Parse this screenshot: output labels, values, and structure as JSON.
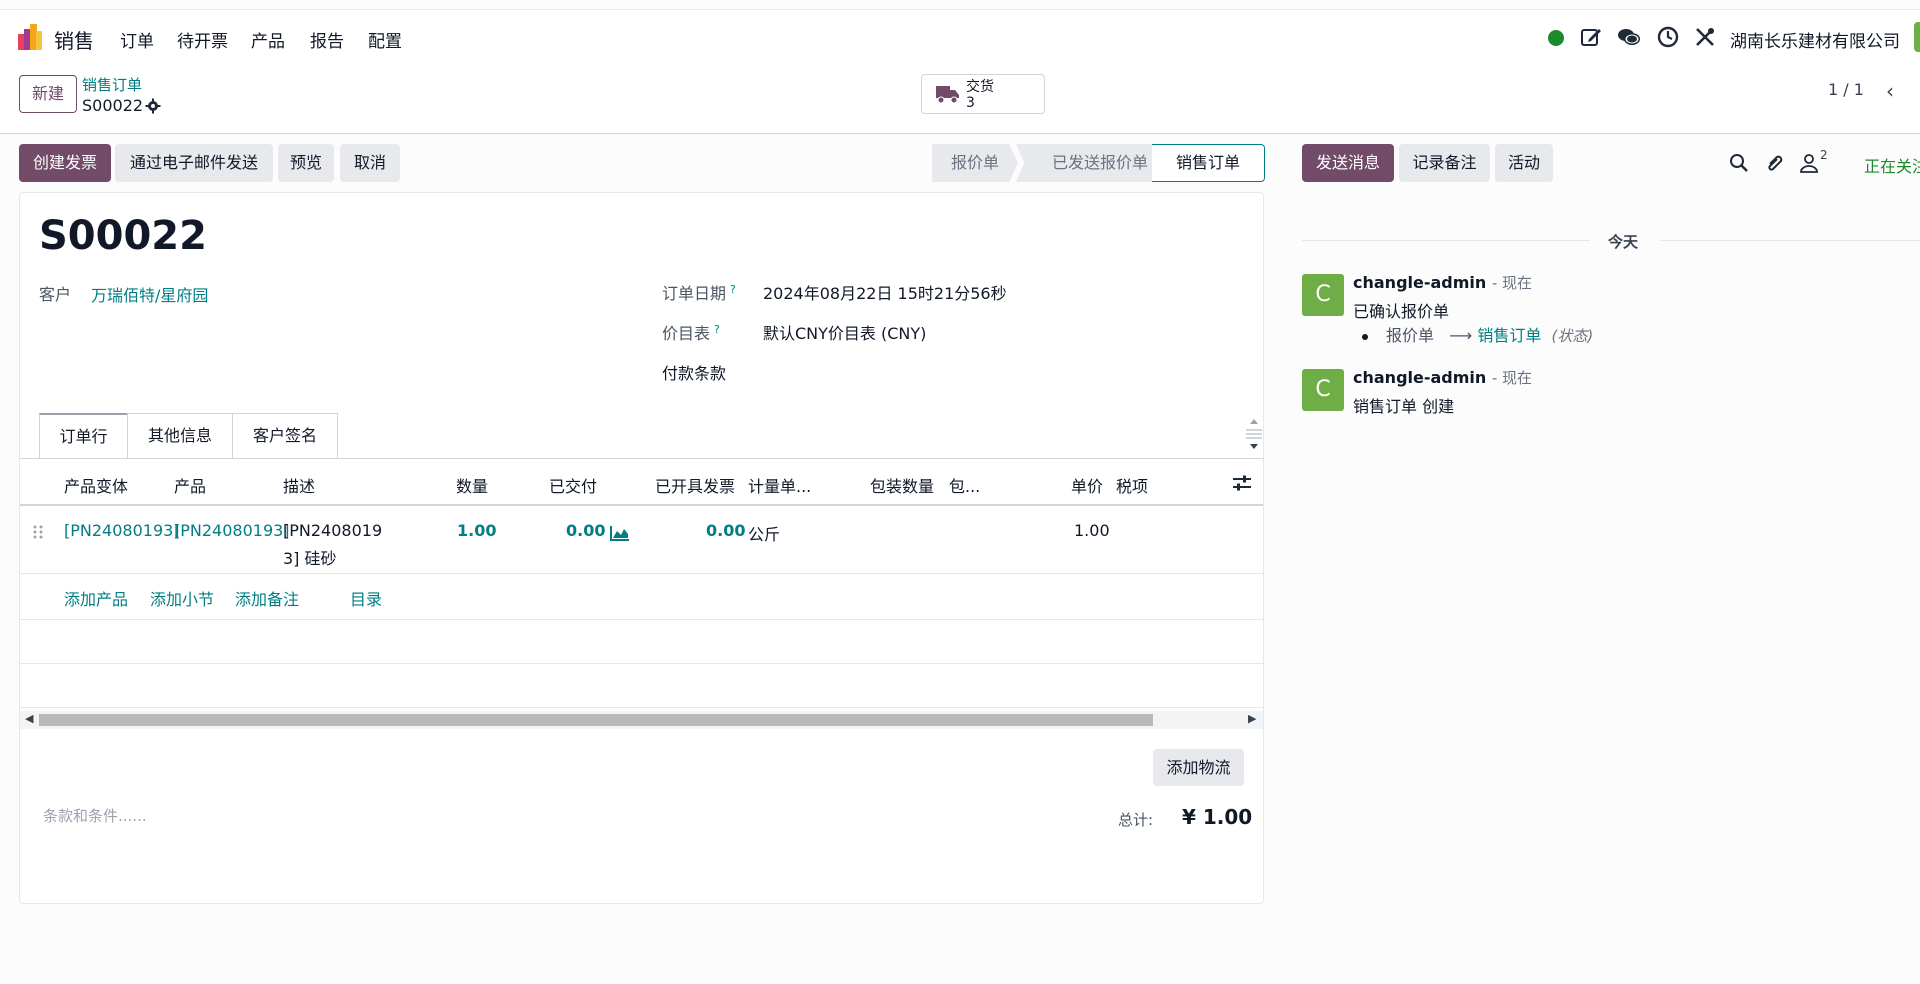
{
  "topnav": {
    "app_name": "销售",
    "menu": [
      "订单",
      "待开票",
      "产品",
      "报告",
      "配置"
    ],
    "company": "湖南长乐建材有限公司",
    "icons": [
      "online-status-icon",
      "edit-icon",
      "chat-icon",
      "clock-icon",
      "tools-icon"
    ],
    "status_color": "#1a8a2a"
  },
  "control": {
    "new_label": "新建",
    "breadcrumb_parent": "销售订单",
    "breadcrumb_current": "S00022",
    "smart_button": {
      "label": "交货",
      "count": "3"
    },
    "pager": "1 / 1"
  },
  "actions": {
    "create_invoice": "创建发票",
    "send_email": "通过电子邮件发送",
    "preview": "预览",
    "cancel": "取消"
  },
  "statusbar": {
    "stages": [
      "报价单",
      "已发送报价单",
      "销售订单"
    ],
    "active": "销售订单"
  },
  "form": {
    "title": "S00022",
    "customer_label": "客户",
    "customer_value": "万瑞佰特/星府园",
    "order_date_label": "订单日期",
    "order_date_value": "2024年08月22日 15时21分56秒",
    "pricelist_label": "价目表",
    "pricelist_value": "默认CNY价目表 (CNY)",
    "payment_terms_label": "付款条款",
    "help_mark": "?"
  },
  "tabs": [
    "订单行",
    "其他信息",
    "客户签名"
  ],
  "table": {
    "headers": [
      "产品变体",
      "产品",
      "描述",
      "数量",
      "已交付",
      "已开具发票",
      "计量单...",
      "包装数量",
      "包...",
      "单价",
      "税项"
    ],
    "rows": [
      {
        "variant": "[PN24080193]",
        "product": "[PN24080193]",
        "description_line1": "[PN2408019",
        "description_line2": "3] 硅砂",
        "quantity": "1.00",
        "delivered": "0.00",
        "invoiced": "0.00",
        "uom": "公斤",
        "unit_price": "1.00"
      }
    ],
    "add_links": [
      "添加产品",
      "添加小节",
      "添加备注",
      "目录"
    ]
  },
  "footer": {
    "add_logistics": "添加物流",
    "terms_placeholder": "条款和条件......",
    "total_label": "总计:",
    "total_value": "¥ 1.00"
  },
  "chatter": {
    "send_message": "发送消息",
    "log_note": "记录备注",
    "activity": "活动",
    "followers_count": "2",
    "following_label": "正在关注",
    "day_label": "今天",
    "messages": [
      {
        "avatar": "C",
        "author": "changle-admin",
        "time": "- 现在",
        "body": "已确认报价单",
        "track_old": "报价单",
        "track_arrow": "⟶",
        "track_new": "销售订单",
        "track_field": "(状态)"
      },
      {
        "avatar": "C",
        "author": "changle-admin",
        "time": "- 现在",
        "body": "销售订单 创建"
      }
    ],
    "avatar_color": "#6fae46"
  },
  "colors": {
    "brand": "#714b67",
    "link": "#017e84"
  }
}
